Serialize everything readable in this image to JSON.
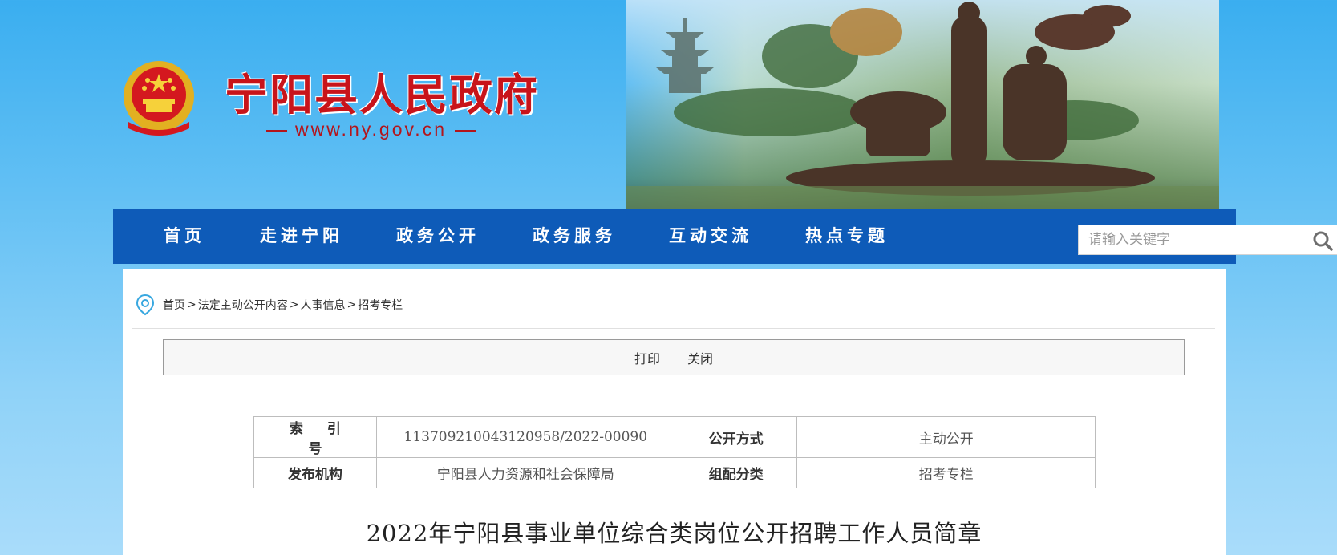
{
  "header": {
    "site_title": "宁阳县人民政府",
    "site_url": "www.ny.gov.cn"
  },
  "nav": {
    "items": [
      {
        "label": "首页"
      },
      {
        "label": "走进宁阳"
      },
      {
        "label": "政务公开"
      },
      {
        "label": "政务服务"
      },
      {
        "label": "互动交流"
      },
      {
        "label": "热点专题"
      }
    ],
    "search": {
      "placeholder": "请输入关键字",
      "icon": "search-icon"
    }
  },
  "breadcrumb": {
    "icon": "location-pin-icon",
    "items": [
      "首页",
      "法定主动公开内容",
      "人事信息",
      "招考专栏"
    ],
    "separator": ">"
  },
  "toolbar": {
    "print_label": "打印",
    "close_label": "关闭"
  },
  "meta": {
    "rows": [
      {
        "label1": "索引号",
        "value1": "113709210043120958/2022-00090",
        "label2": "公开方式",
        "value2": "主动公开"
      },
      {
        "label1": "发布机构",
        "value1": "宁阳县人力资源和社会保障局",
        "label2": "组配分类",
        "value2": "招考专栏"
      }
    ]
  },
  "article": {
    "title": "2022年宁阳县事业单位综合类岗位公开招聘工作人员简章"
  },
  "colors": {
    "nav_bg": "#0e5bb8",
    "title_red": "#c8141a",
    "page_bg": "#4db6f2"
  }
}
